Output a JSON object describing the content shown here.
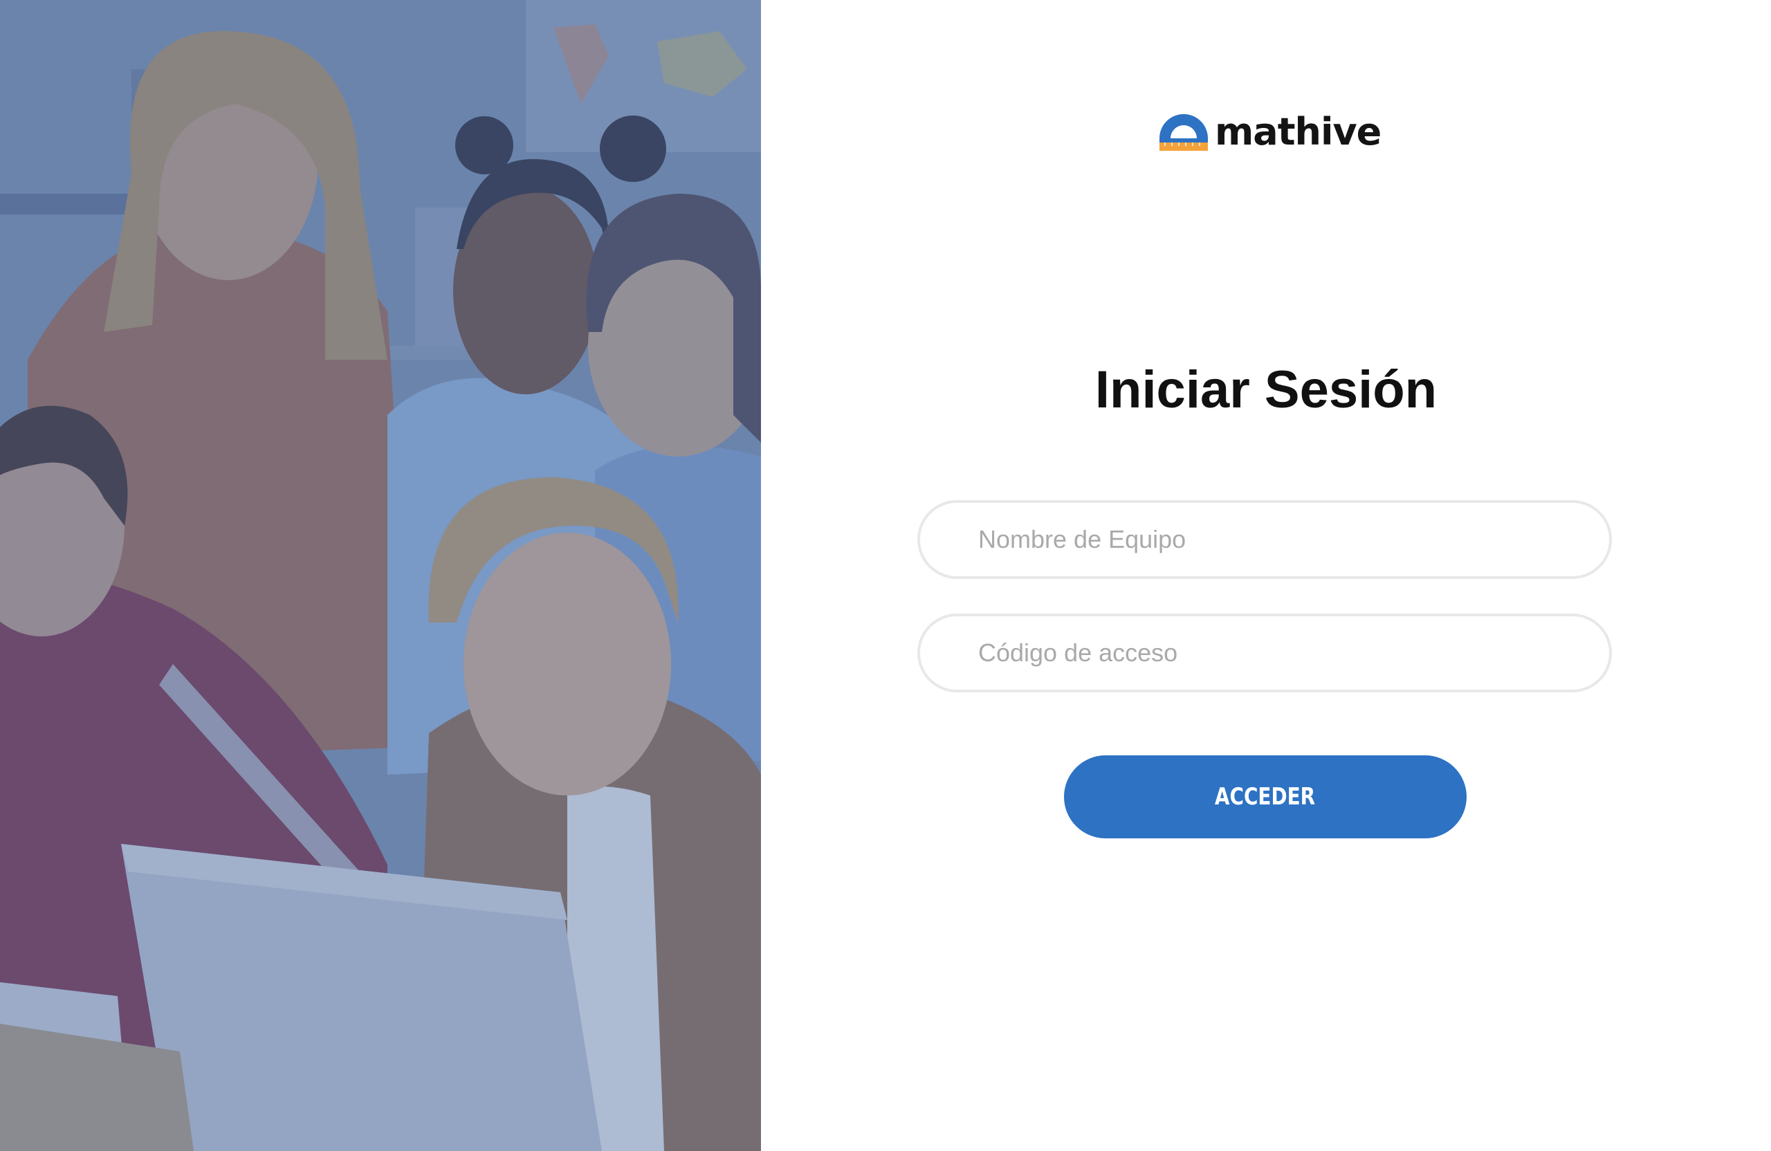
{
  "brand": {
    "name": "mathive",
    "colors": {
      "blue": "#2d72c3",
      "orange": "#f5a23a"
    }
  },
  "hero_image": {
    "icon": "students-at-laptop-photo",
    "overlay_color": "#5b78a8"
  },
  "login": {
    "title": "Iniciar Sesión",
    "team_field": {
      "placeholder": "Nombre de Equipo",
      "value": ""
    },
    "code_field": {
      "placeholder": "Código de acceso",
      "value": ""
    },
    "submit_label": "ACCEDER"
  }
}
